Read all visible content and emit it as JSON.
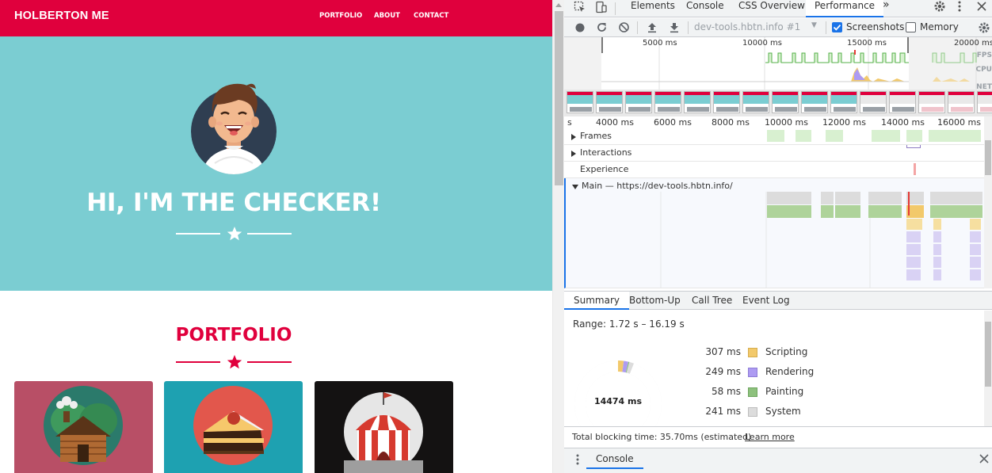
{
  "site": {
    "brand": "HOLBERTON ME",
    "nav": [
      "PORTFOLIO",
      "ABOUT",
      "CONTACT"
    ],
    "hero_title": "HI, I'M THE CHECKER!",
    "portfolio_title": "PORTFOLIO",
    "colors": {
      "primary": "#e0003d",
      "hero_bg": "#7bcdd2",
      "card1": "#b84f66",
      "card2": "#1ea1b1",
      "card3": "#141212"
    },
    "cards": [
      "cabin-illustration",
      "cake-illustration",
      "circus-tent-illustration"
    ]
  },
  "devtools": {
    "tabs": [
      "Elements",
      "Console",
      "CSS Overview",
      "Performance"
    ],
    "active_tab": "Performance",
    "more_tabs_icon": "chevron-double-right-icon",
    "recording": "dev-tools.hbtn.info #1",
    "screenshots_label": "Screenshots",
    "screenshots_checked": true,
    "memory_label": "Memory",
    "memory_checked": false,
    "overview_ticks": [
      "5000 ms",
      "10000 ms",
      "15000 ms",
      "20000 ms"
    ],
    "overview_lanes": [
      "FPS",
      "CPU",
      "NET"
    ],
    "flame_ticks": [
      "s",
      "4000 ms",
      "6000 ms",
      "8000 ms",
      "10000 ms",
      "12000 ms",
      "14000 ms",
      "16000 ms"
    ],
    "tracks": [
      "Frames",
      "Interactions",
      "Experience",
      "Main — https://dev-tools.hbtn.info/"
    ],
    "bottom_tabs": [
      "Summary",
      "Bottom-Up",
      "Call Tree",
      "Event Log"
    ],
    "range": "Range: 1.72 s – 16.19 s",
    "total": "14474 ms",
    "summary": [
      {
        "value": "307 ms",
        "name": "Scripting",
        "color": "#f2c96b"
      },
      {
        "value": "249 ms",
        "name": "Rendering",
        "color": "#ad9bf2"
      },
      {
        "value": "58 ms",
        "name": "Painting",
        "color": "#8dc17d"
      },
      {
        "value": "241 ms",
        "name": "System",
        "color": "#dcdcdc"
      }
    ],
    "blocking": "Total blocking time: 35.70ms (estimated)",
    "learn_more": "Learn more",
    "drawer_tab": "Console"
  }
}
